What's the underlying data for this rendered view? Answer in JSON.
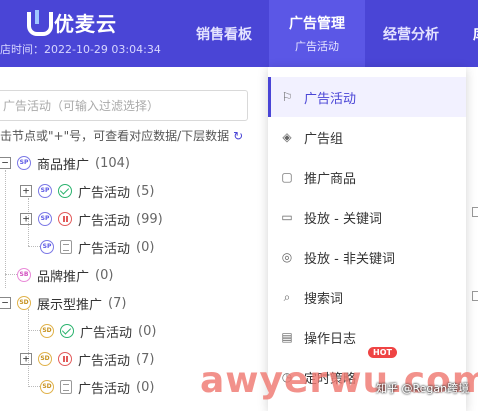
{
  "app": {
    "logo_text": "优麦云",
    "timestamp": "店时间：2022-10-29 03:04:34"
  },
  "nav": {
    "items": [
      {
        "label": "销售看板"
      },
      {
        "label": "广告管理",
        "sub": "广告活动"
      },
      {
        "label": "经营分析"
      },
      {
        "label": "库"
      }
    ]
  },
  "search": {
    "placeholder": "广告活动（可输入过滤选择）"
  },
  "hint": {
    "text": "击节点或\"+\"号，可查看对应数据/下层数据",
    "refresh_icon": "↻"
  },
  "tree": [
    {
      "expander": "−",
      "badge": "SP",
      "label": "商品推广",
      "count": "(104)"
    },
    {
      "expander": "+",
      "badge": "SP",
      "status": "ok",
      "label": "广告活动",
      "count": "(5)"
    },
    {
      "expander": "+",
      "badge": "SP",
      "status": "pause",
      "label": "广告活动",
      "count": "(99)"
    },
    {
      "badge": "SP",
      "status": "doc",
      "label": "广告活动",
      "count": "(0)"
    },
    {
      "badge": "SB",
      "label": "品牌推广",
      "count": "(0)"
    },
    {
      "expander": "−",
      "badge": "SD",
      "label": "展示型推广",
      "count": "(7)"
    },
    {
      "badge": "SD",
      "status": "ok",
      "label": "广告活动",
      "count": "(0)"
    },
    {
      "expander": "+",
      "badge": "SD",
      "status": "pause",
      "label": "广告活动",
      "count": "(7)"
    },
    {
      "badge": "SD",
      "status": "doc",
      "label": "广告活动",
      "count": "(0)"
    }
  ],
  "menu": {
    "items": [
      {
        "label": "广告活动",
        "icon": "flag-icon"
      },
      {
        "label": "广告组",
        "icon": "layers-icon"
      },
      {
        "label": "推广商品",
        "icon": "cart-icon"
      },
      {
        "label": "投放 - 关键词",
        "icon": "keyword-icon"
      },
      {
        "label": "投放 - 非关键词",
        "icon": "target-icon"
      },
      {
        "label": "搜索词",
        "icon": "search-icon"
      },
      {
        "label": "操作日志",
        "icon": "log-icon"
      },
      {
        "label": "定时策略",
        "icon": "clock-icon",
        "badge": "HOT"
      }
    ]
  },
  "watermark": {
    "main": "awyerwu.com",
    "sub": "知乎 @Regan跨境"
  },
  "colors": {
    "primary": "#4a45d6",
    "active_nav": "#5b57e6",
    "status_ok": "#2bb36e",
    "status_pause": "#e25a5a",
    "hot": "#ef4444"
  }
}
